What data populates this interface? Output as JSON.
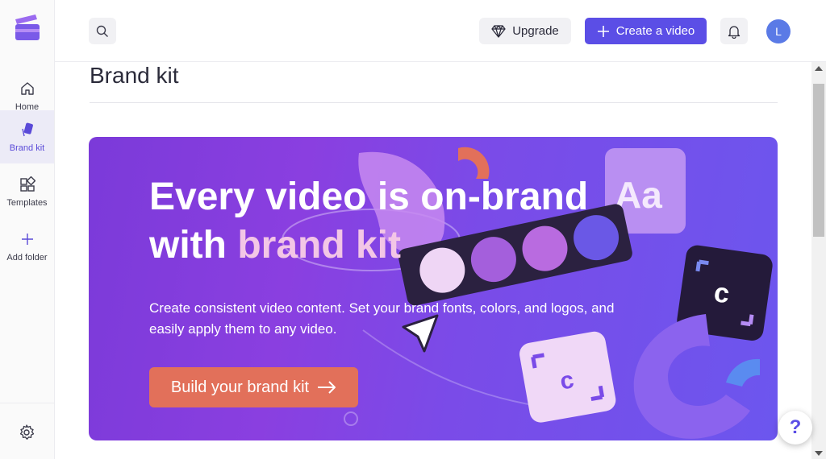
{
  "sidebar": {
    "items": [
      {
        "label": "Home",
        "icon": "home-icon"
      },
      {
        "label": "Brand kit",
        "icon": "brand-kit-icon"
      },
      {
        "label": "Templates",
        "icon": "templates-icon"
      },
      {
        "label": "Add folder",
        "icon": "plus-icon"
      }
    ],
    "settings_icon": "gear-icon"
  },
  "header": {
    "search_icon": "search-icon",
    "upgrade_label": "Upgrade",
    "create_label": "Create a video",
    "bell_icon": "bell-icon",
    "avatar_initial": "L"
  },
  "main": {
    "title": "Brand kit",
    "hero": {
      "headline_part1": "Every video is on-brand with ",
      "headline_accent": "brand kit",
      "subtitle": "Create consistent video content. Set your brand fonts, colors, and logos, and easily apply them to any video.",
      "cta_label": "Build your brand kit",
      "art_text": "Aa",
      "art_letter": "c"
    }
  },
  "help": {
    "label": "?"
  },
  "colors": {
    "accent": "#5b4ee6",
    "cta": "#e2705a",
    "accent_text": "#f3c6e6",
    "active_nav_bg": "#ecebf7"
  }
}
